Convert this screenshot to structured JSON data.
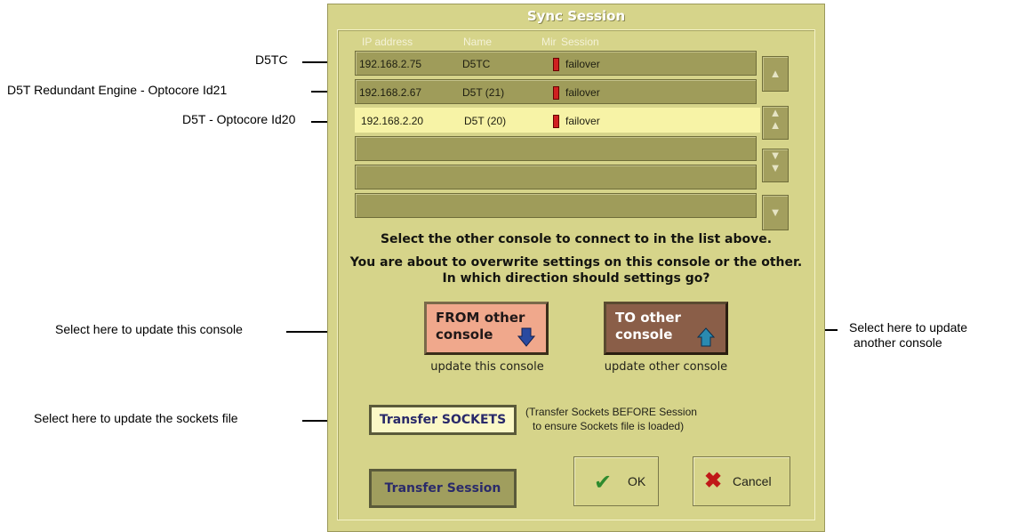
{
  "dialog": {
    "title": "Sync Session",
    "columns": [
      "IP address",
      "Name",
      "Mir",
      "Session"
    ],
    "rows": [
      {
        "ip": "192.168.2.75",
        "name": "D5TC",
        "session": "failover",
        "mir_color": "#d02020"
      },
      {
        "ip": "192.168.2.67",
        "name": "D5T (21)",
        "session": "failover",
        "mir_color": "#d02020"
      },
      {
        "ip": "192.168.2.20",
        "name": "D5T (20)",
        "session": "failover",
        "mir_color": "#d02020",
        "selected": true
      },
      {
        "ip": "",
        "name": "",
        "session": ""
      },
      {
        "ip": "",
        "name": "",
        "session": ""
      },
      {
        "ip": "",
        "name": "",
        "session": ""
      }
    ],
    "scroll_icons": [
      "scroll-up-icon",
      "page-up-icon",
      "page-down-icon",
      "scroll-down-icon"
    ],
    "message_1": "Select the other console to connect to in the list above.",
    "message_2": "You are about to overwrite settings on this console or the other.",
    "message_3": "In which direction should settings go?",
    "from_button": {
      "line1": "FROM other",
      "line2": "console",
      "sublabel": "update this console"
    },
    "to_button": {
      "line1": "TO other",
      "line2": "console",
      "sublabel": "update other console"
    },
    "sockets_button": "Transfer SOCKETS",
    "sockets_note_1": "(Transfer Sockets BEFORE Session",
    "sockets_note_2": "to ensure Sockets file is loaded)",
    "session_button": "Transfer Session",
    "ok_button": "OK",
    "cancel_button": "Cancel"
  },
  "callouts": {
    "d5tc": "D5TC",
    "d5t_redundant": "D5T Redundant Engine - Optocore Id21",
    "d5t": "D5T - Optocore Id20",
    "update_this": "Select here to update this console",
    "update_another_1": "Select here to update",
    "update_another_2": "another console",
    "update_sockets": "Select here to update the sockets file"
  },
  "colors": {
    "dialog_bg": "#d6d48a",
    "row_bg": "#9f9c5a",
    "selected_row": "#f7f3a6",
    "from_button": "#f0a88c",
    "to_button": "#8a5e48"
  }
}
